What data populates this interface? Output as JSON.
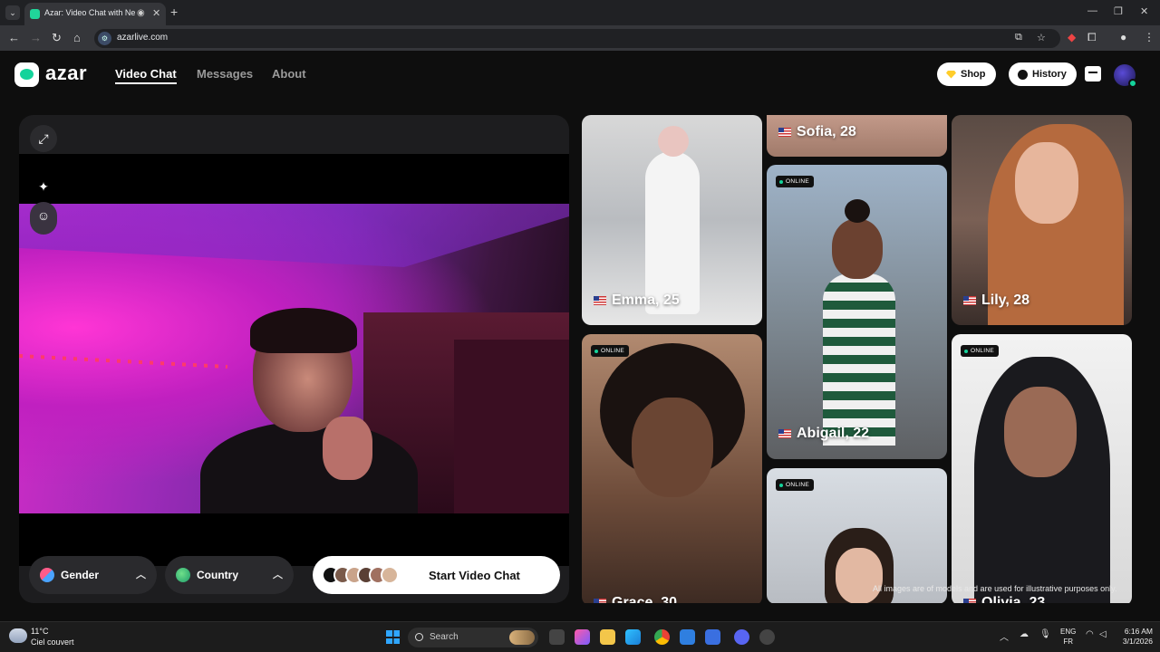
{
  "browser": {
    "tab_title": "Azar: Video Chat with New",
    "url": "azarlive.com",
    "new_tab_label": "+",
    "close_label": "✕"
  },
  "site": {
    "logo_text": "azar",
    "nav": [
      "Video Chat",
      "Messages",
      "About"
    ],
    "shop_label": "Shop",
    "history_label": "History"
  },
  "video_panel": {
    "gender_label": "Gender",
    "country_label": "Country",
    "start_label": "Start Video Chat"
  },
  "gallery": {
    "online_label": "ONLINE",
    "cards": [
      {
        "name": "Emma, 25",
        "online": false
      },
      {
        "name": "Sofia, 28",
        "online": false
      },
      {
        "name": "Lily, 28",
        "online": false
      },
      {
        "name": "Abigail, 22",
        "online": true
      },
      {
        "name": "Grace, 30",
        "online": true
      },
      {
        "name": "Olivia, 23",
        "online": true
      },
      {
        "name": "",
        "online": true
      }
    ],
    "disclaimer": "All images are of models and are used for illustrative purposes only."
  },
  "taskbar": {
    "temperature": "11°C",
    "weather": "Ciel couvert",
    "search_placeholder": "Search",
    "lang_top": "ENG",
    "lang_bottom": "FR",
    "time": "6:16 AM",
    "date": "3/1/2026"
  },
  "colors": {
    "accent": "#14d39b",
    "background": "#0e0e0e",
    "panel": "#1d1d1f"
  }
}
